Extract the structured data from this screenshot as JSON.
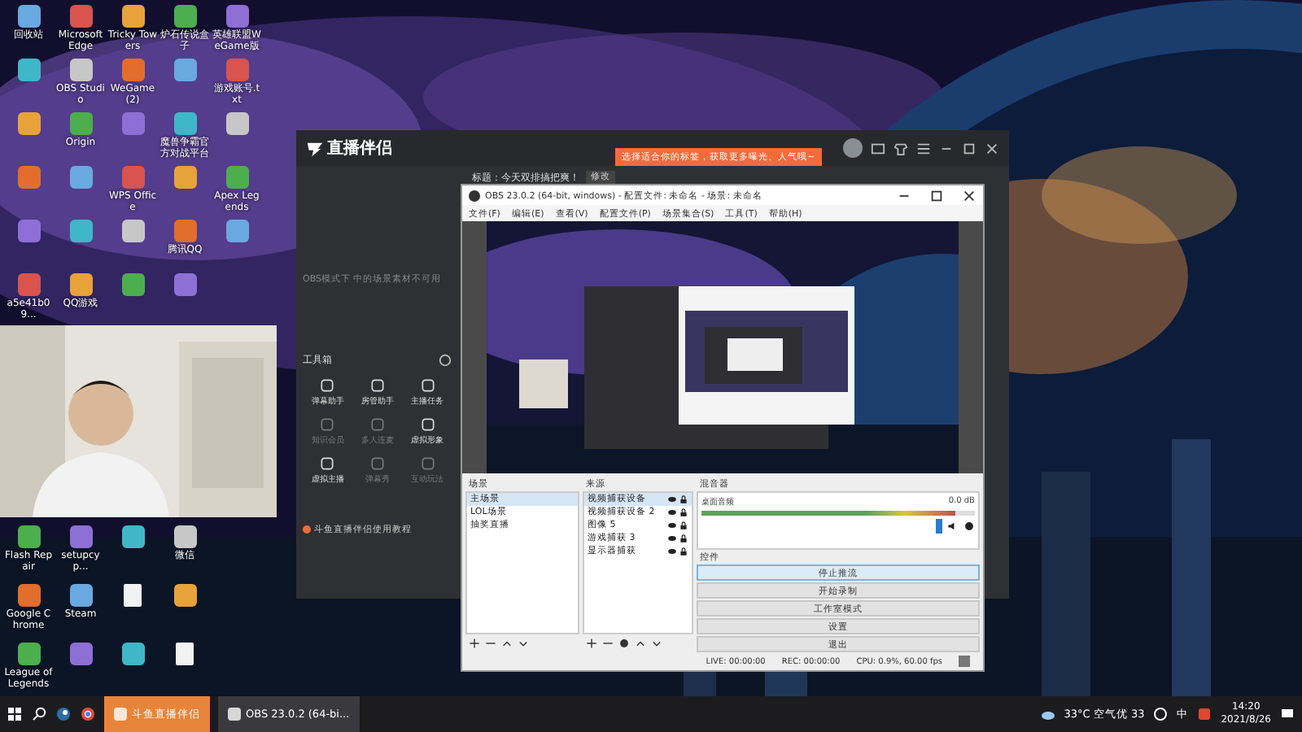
{
  "desktop": {
    "icons_top": [
      {
        "kind": "shortcut",
        "label": "回收站"
      },
      {
        "kind": "shortcut",
        "label": "Microsoft Edge"
      },
      {
        "kind": "shortcut",
        "label": "Tricky Towers"
      },
      {
        "kind": "shortcut",
        "label": "炉石传说盒子"
      },
      {
        "kind": "shortcut",
        "label": "英雄联盟WeGame版"
      },
      {
        "kind": "shortcut"
      },
      {
        "kind": "shortcut",
        "label": "OBS Studio"
      },
      {
        "kind": "shortcut",
        "label": "WeGame (2)"
      },
      {
        "kind": "shortcut"
      },
      {
        "kind": "shortcut",
        "label": "游戏账号.txt"
      },
      {
        "kind": "shortcut"
      },
      {
        "kind": "shortcut",
        "label": "Origin"
      },
      {
        "kind": "shortcut"
      },
      {
        "kind": "shortcut",
        "label": "魔兽争霸官方对战平台"
      },
      {
        "kind": "shortcut"
      },
      {
        "kind": "shortcut"
      },
      {
        "kind": "shortcut"
      },
      {
        "kind": "shortcut",
        "label": "WPS Office"
      },
      {
        "kind": "shortcut"
      },
      {
        "kind": "shortcut",
        "label": "Apex Legends"
      },
      {
        "kind": "shortcut"
      },
      {
        "kind": "shortcut"
      },
      {
        "kind": "shortcut"
      },
      {
        "kind": "shortcut",
        "label": "腾讯QQ"
      },
      {
        "kind": "shortcut"
      },
      {
        "kind": "shortcut",
        "label": "a5e41b09..."
      },
      {
        "kind": "shortcut",
        "label": "QQ游戏"
      },
      {
        "kind": "shortcut"
      },
      {
        "kind": "shortcut"
      }
    ],
    "icons_bottom": [
      {
        "kind": "shortcut",
        "label": "Flash Repair"
      },
      {
        "kind": "shortcut",
        "label": "setupcyp..."
      },
      {
        "kind": "shortcut"
      },
      {
        "kind": "shortcut",
        "label": "微信"
      },
      {
        "kind": "shortcut",
        "label": "Google Chrome"
      },
      {
        "kind": "shortcut",
        "label": "Steam"
      },
      {
        "kind": "file"
      },
      {
        "kind": "shortcut"
      },
      {
        "kind": "shortcut",
        "label": "League of Legends"
      },
      {
        "kind": "shortcut"
      },
      {
        "kind": "shortcut"
      },
      {
        "kind": "file"
      }
    ]
  },
  "douyu_app": {
    "logo": "直播伴侣",
    "tooltip": "选择适合你的标签，获取更多曝光、人气哦~",
    "title_text": "标题：今天双排搞把爽！",
    "title_edit": "修改",
    "empty_note": "OBS模式下 中的场景素材不可用",
    "toolbox_title": "工具箱",
    "tools": [
      {
        "label": "弹幕助手",
        "disabled": false
      },
      {
        "label": "房管助手",
        "disabled": false
      },
      {
        "label": "主播任务",
        "disabled": false
      },
      {
        "label": "知识会员",
        "disabled": true
      },
      {
        "label": "多人连麦",
        "disabled": true
      },
      {
        "label": "虚拟形象",
        "disabled": false
      },
      {
        "label": "虚拟主播",
        "disabled": false
      },
      {
        "label": "弹幕秀",
        "disabled": true
      },
      {
        "label": "互动玩法",
        "disabled": true
      }
    ],
    "tutorial": "斗鱼直播伴侣使用教程"
  },
  "obs": {
    "title": "OBS 23.0.2 (64-bit, windows) - 配置文件: 未命名 - 场景: 未命名",
    "menu": [
      "文件(F)",
      "编辑(E)",
      "查看(V)",
      "配置文件(P)",
      "场景集合(S)",
      "工具(T)",
      "帮助(H)"
    ],
    "scenes": {
      "title": "场景",
      "items": [
        {
          "label": "主场景",
          "selected": true
        },
        {
          "label": "LOL场景",
          "selected": false
        },
        {
          "label": "抽奖直播",
          "selected": false
        }
      ]
    },
    "sources": {
      "title": "来源",
      "items": [
        {
          "label": "视频捕获设备",
          "selected": true
        },
        {
          "label": "视频捕获设备 2",
          "selected": false
        },
        {
          "label": "图像 5",
          "selected": false
        },
        {
          "label": "游戏捕获 3",
          "selected": false
        },
        {
          "label": "显示器捕获",
          "selected": false
        }
      ]
    },
    "mixer": {
      "title": "混音器",
      "channel": "桌面音频",
      "reading": "0.0 dB",
      "level": 0.93
    },
    "controls": {
      "title": "控件",
      "buttons": [
        {
          "label": "停止推流",
          "selected": true
        },
        {
          "label": "开始录制",
          "selected": false
        },
        {
          "label": "工作室模式",
          "selected": false
        },
        {
          "label": "设置",
          "selected": false
        },
        {
          "label": "退出",
          "selected": false
        }
      ]
    },
    "status": [
      "LIVE: 00:00:00",
      "REC: 00:00:00",
      "CPU: 0.9%, 60.00 fps"
    ]
  },
  "taskbar": {
    "apps": [
      {
        "label": "斗鱼直播伴侣",
        "selected": true
      },
      {
        "label": "OBS 23.0.2 (64-bi...",
        "selected": false
      }
    ],
    "weather": "33°C 空气优 33",
    "ime": "中",
    "time": "14:20",
    "date": "2021/8/26"
  }
}
